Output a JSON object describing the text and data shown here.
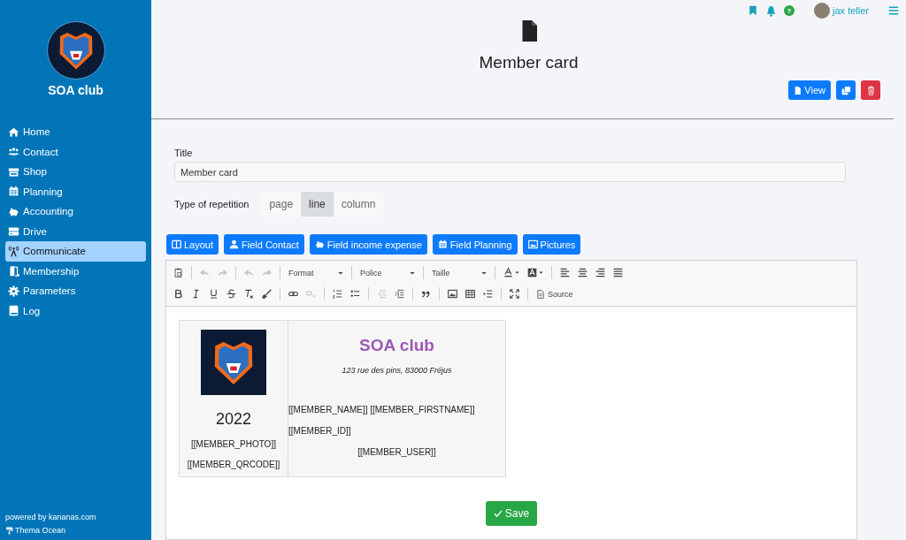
{
  "sidebar": {
    "club_name": "SOA club",
    "items": [
      {
        "label": "Home",
        "selected": false
      },
      {
        "label": "Contact",
        "selected": false
      },
      {
        "label": "Shop",
        "selected": false
      },
      {
        "label": "Planning",
        "selected": false
      },
      {
        "label": "Accounting",
        "selected": false
      },
      {
        "label": "Drive",
        "selected": false
      },
      {
        "label": "Communicate",
        "selected": true
      },
      {
        "label": "Membership",
        "selected": false
      },
      {
        "label": "Parameters",
        "selected": false
      },
      {
        "label": "Log",
        "selected": false
      }
    ],
    "footer": {
      "powered_by": "powered by kananas.com",
      "theme": "Thema Ocean"
    }
  },
  "topbar": {
    "user_name": "jax teller",
    "help": "?"
  },
  "page": {
    "title": "Member card",
    "actions": [
      {
        "kind": "view",
        "label": "View"
      },
      {
        "kind": "duplicate"
      },
      {
        "kind": "delete"
      }
    ]
  },
  "form": {
    "title_label": "Title",
    "title_value": "Member card",
    "repetition_label": "Type of repetition",
    "repetition_options": [
      {
        "label": "page",
        "selected": false
      },
      {
        "label": "line",
        "selected": true
      },
      {
        "label": "column",
        "selected": false
      }
    ],
    "insert_buttons": [
      "Layout",
      "Field Contact",
      "Field income expense",
      "Field Planning",
      "Pictures"
    ]
  },
  "editor": {
    "toolbar": {
      "rows": [
        [
          {
            "disabled": false
          },
          {
            "disabled": true
          },
          {
            "disabled": true
          },
          {
            "disabled": true
          },
          {
            "disabled": true
          }
        ],
        [
          {
            "disabled": false
          },
          {
            "disabled": false
          },
          {
            "disabled": false
          },
          {
            "disabled": false
          },
          {
            "disabled": false
          },
          {
            "disabled": false
          },
          {
            "disabled": false
          },
          {
            "disabled": true
          },
          {
            "disabled": false
          },
          {
            "disabled": false
          },
          {
            "disabled": true
          },
          {
            "disabled": false
          },
          {
            "disabled": false
          },
          {
            "disabled": false
          },
          {
            "disabled": false
          },
          {
            "disabled": false
          },
          {
            "disabled": false
          }
        ]
      ],
      "dropdowns": [
        "Format",
        "Police",
        "Taille"
      ],
      "source": "Source"
    },
    "card": {
      "year": "2022",
      "left_fields": [
        "[[MEMBER_PHOTO]]",
        "[[MEMBER_QRCODE]]"
      ],
      "club_name": "SOA club",
      "address": "123 rue des pins, 83000 Fréjus",
      "right_fields": [
        {
          "text": "[[MEMBER_NAME]] [[MEMBER_FIRSTNAME]]",
          "kind": "plain"
        },
        {
          "text": "[[MEMBER_ID]]",
          "kind": "plain"
        },
        {
          "text": "[[MEMBER_USER]]",
          "kind": "centered"
        }
      ]
    }
  },
  "save_button": "Save"
}
